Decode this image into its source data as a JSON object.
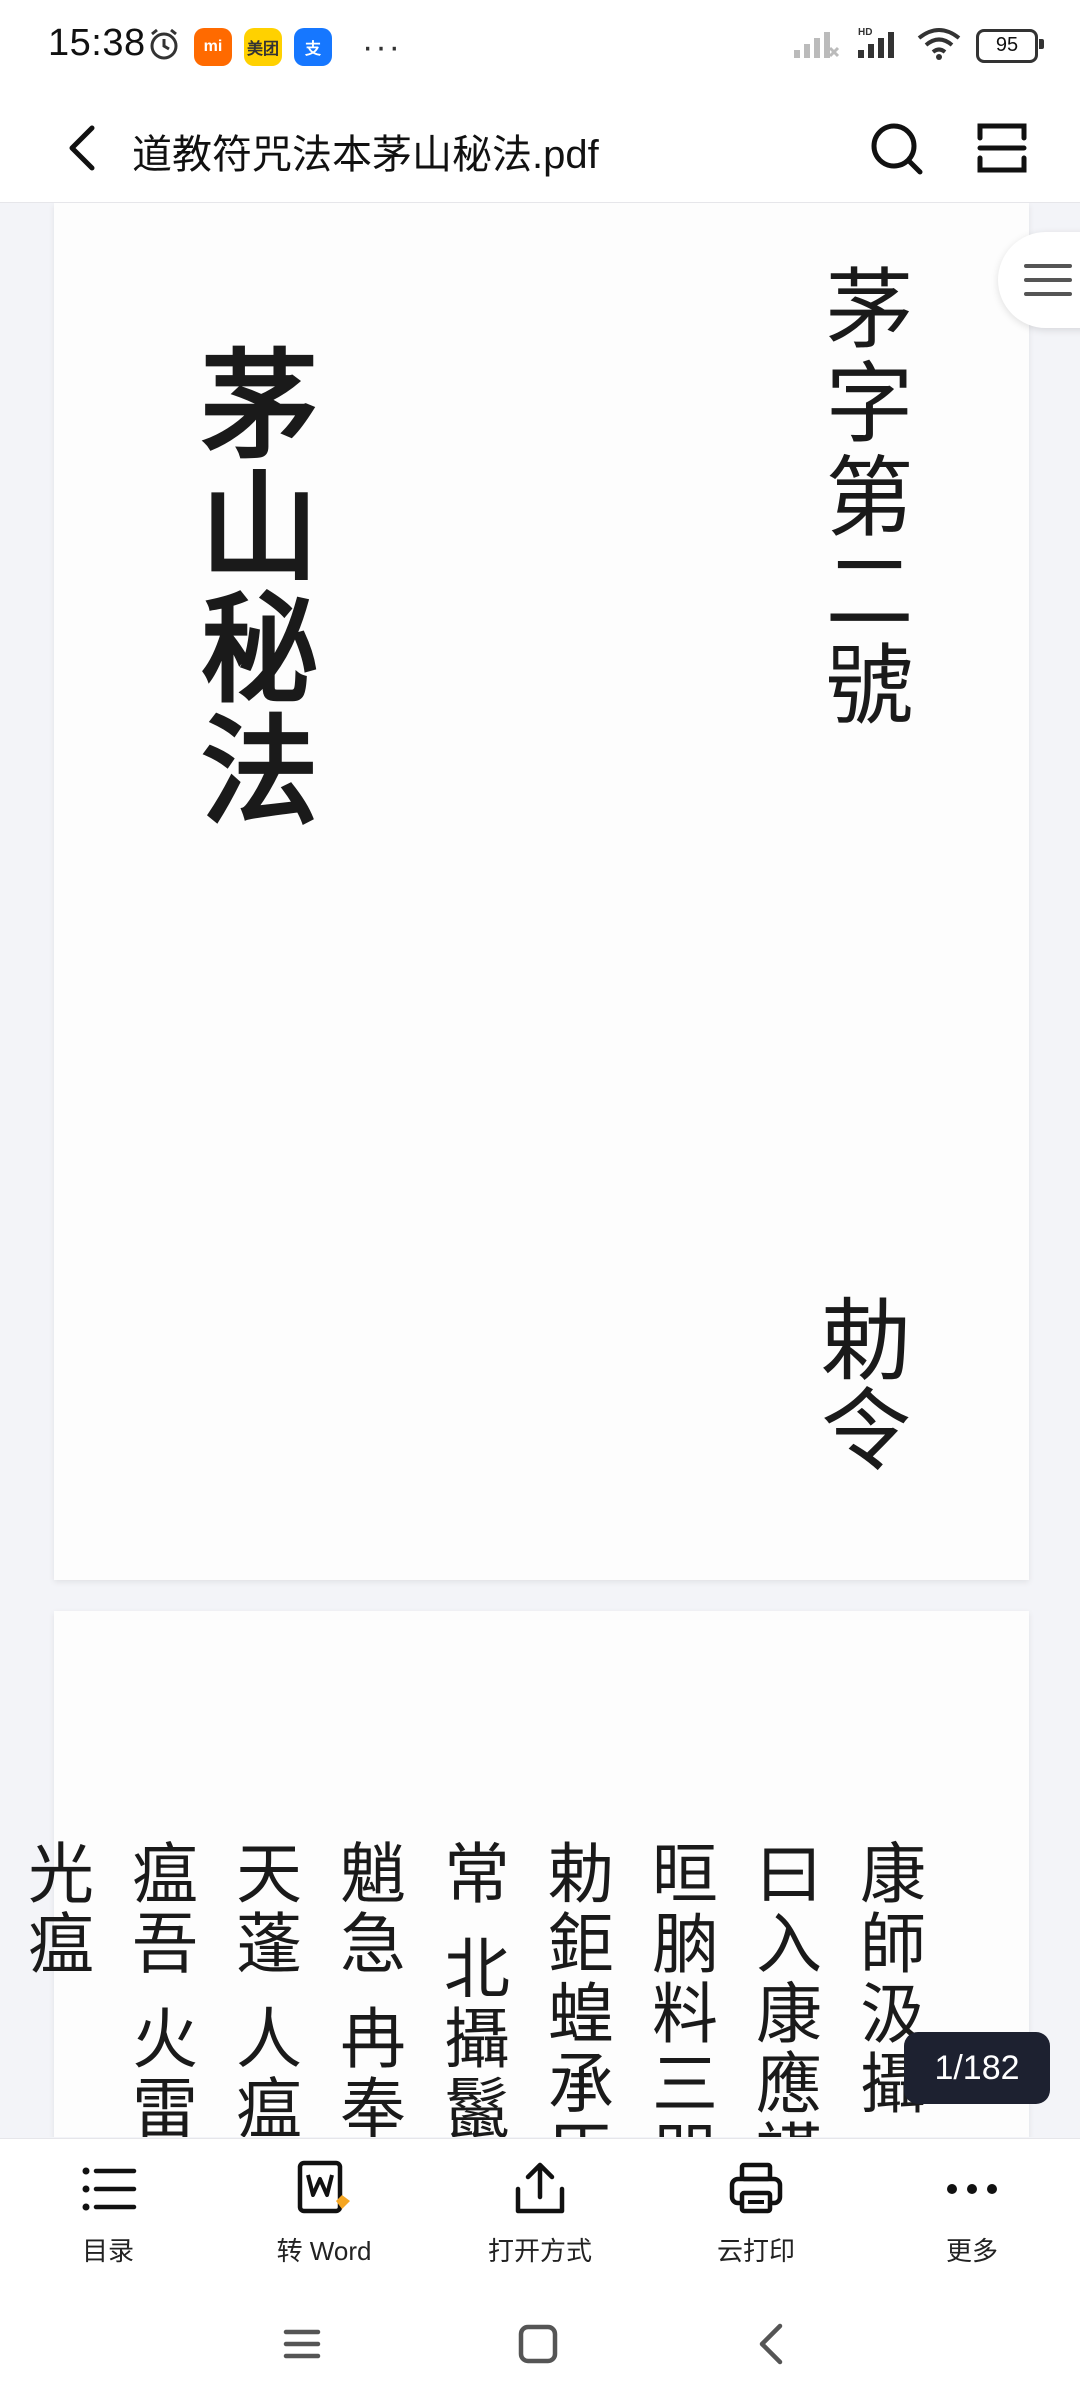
{
  "status_bar": {
    "time": "15:38",
    "battery": "95",
    "app_badges": [
      {
        "label": "mi",
        "color": "#ff6a00"
      },
      {
        "label": "美团",
        "color": "#ffd100"
      },
      {
        "label": "支",
        "color": "#1677ff"
      }
    ],
    "overflow": "···"
  },
  "header": {
    "title": "道教符咒法本茅山秘法.pdf"
  },
  "document": {
    "page1": {
      "title": "茅山秘法",
      "number": "茅字第二號",
      "seal": "勅令"
    },
    "page2": {
      "text": "康師汲攝 曰入康應謹 晅朒料三咒 勅鉅蝗承臣常 北攝鬣魈急 冉奉天蓬 人瘟瘟吾 火雷光瘟"
    }
  },
  "page_indicator": "1/182",
  "toolbar": {
    "items": [
      {
        "label": "目录"
      },
      {
        "label": "转 Word"
      },
      {
        "label": "打开方式"
      },
      {
        "label": "云打印"
      },
      {
        "label": "更多"
      }
    ]
  }
}
